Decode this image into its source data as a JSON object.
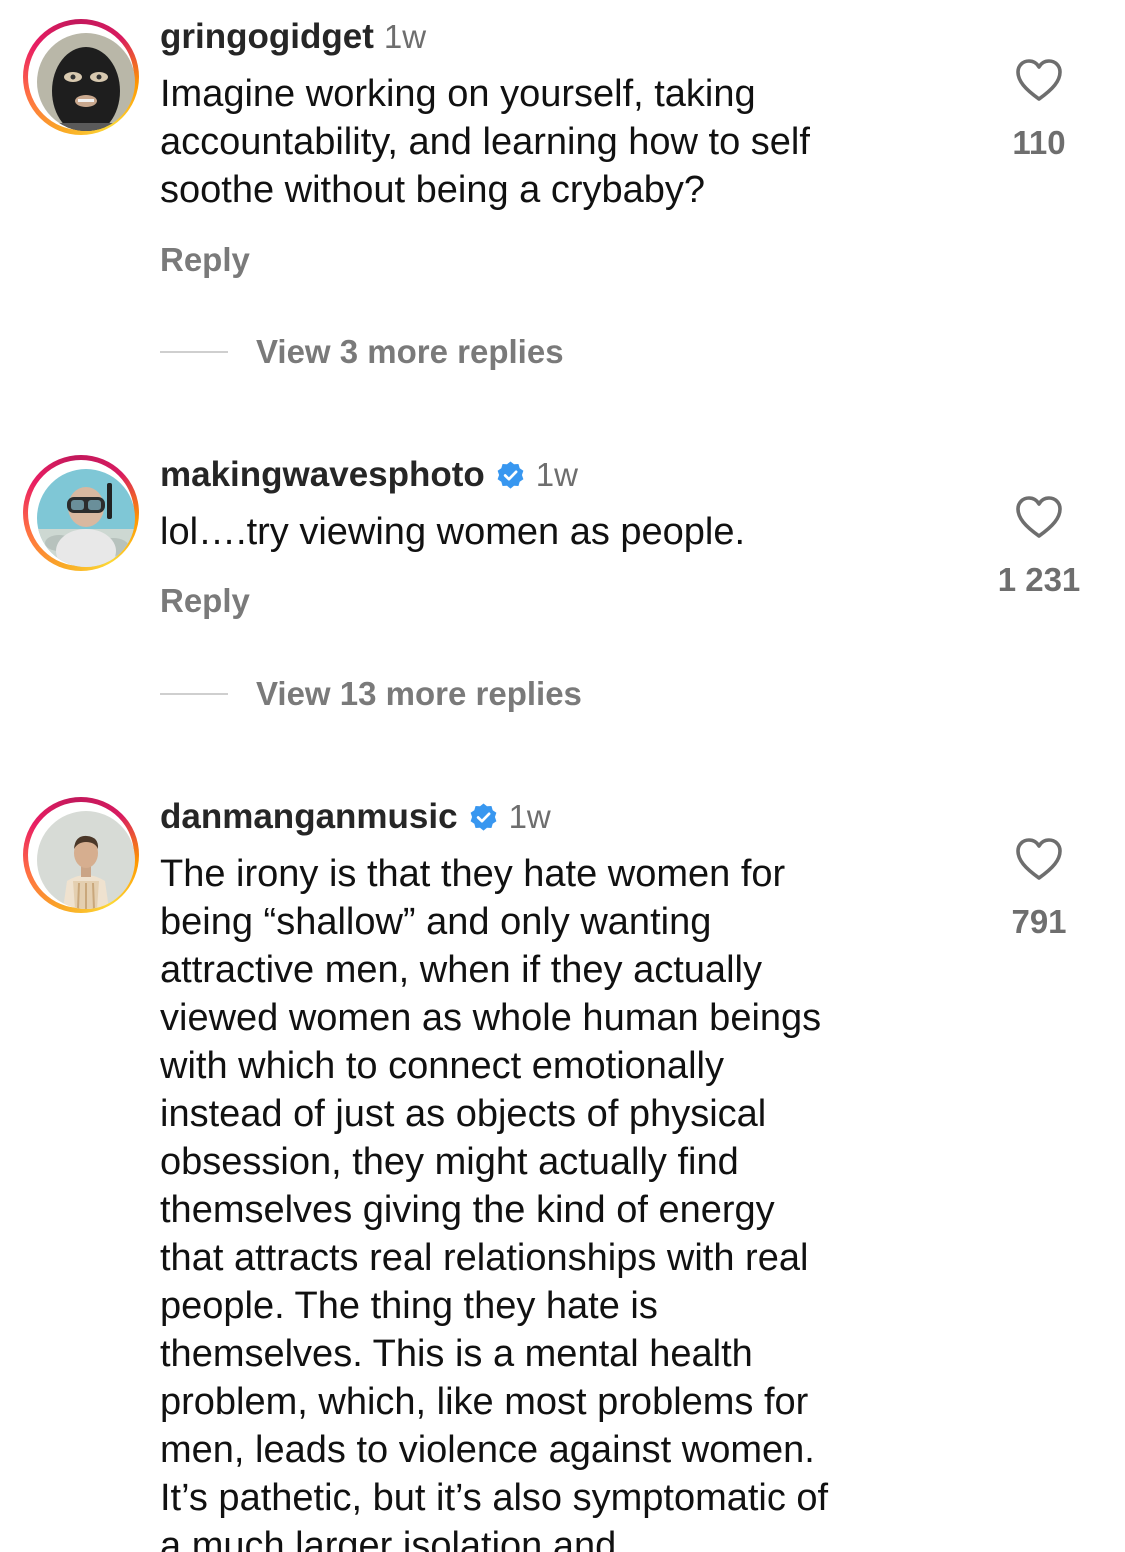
{
  "colors": {
    "text": "#111111",
    "muted": "#7a7a7a",
    "verified": "#3897f0",
    "ring_start": "#f9a825",
    "ring_end": "#e91e63"
  },
  "icons": {
    "like": "heart-outline-icon",
    "verified": "verified-badge-icon"
  },
  "comments": [
    {
      "username": "gringogidget",
      "verified": false,
      "time": "1w",
      "text": "Imagine working on yourself, taking\naccountability, and learning how to self\nsoothe without being a crybaby?",
      "reply_label": "Reply",
      "view_replies": "View 3 more replies",
      "likes": "110",
      "avatar": "balaclava-avatar"
    },
    {
      "username": "makingwavesphoto",
      "verified": true,
      "time": "1w",
      "text": "lol….try viewing women as people.",
      "reply_label": "Reply",
      "view_replies": "View 13 more replies",
      "likes": "1 231",
      "avatar": "snorkel-diver-avatar"
    },
    {
      "username": "danmanganmusic",
      "verified": true,
      "time": "1w",
      "text": "The irony is that they hate women for\nbeing “shallow” and only wanting\nattractive men, when if they actually\nviewed women as whole human beings\nwith which to connect emotionally\ninstead of just as objects of physical\nobsession, they might actually find\nthemselves giving the kind of energy\nthat attracts real relationships with real\npeople. The thing they hate is\nthemselves. This is a mental health\nproblem, which, like most problems for\nmen, leads to violence against women.\nIt’s pathetic, but it’s also symptomatic of\na much larger isolation and",
      "likes": "791",
      "avatar": "man-portrait-avatar"
    }
  ]
}
